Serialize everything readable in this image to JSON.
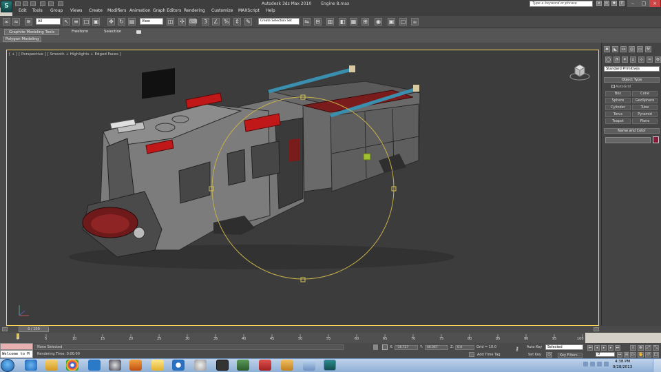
{
  "titlebar": {
    "app_name": "Autodesk 3ds Max 2010",
    "file_name": "Engine 8.max",
    "search_placeholder": "Type a keyword or phrase",
    "logo_glyph": "S"
  },
  "menu": [
    "Edit",
    "Tools",
    "Group",
    "Views",
    "Create",
    "Modifiers",
    "Animation",
    "Graph Editors",
    "Rendering",
    "Customize",
    "MAXScript",
    "Help"
  ],
  "toolbar": {
    "selection_filter": "All",
    "reference_coord": "View",
    "named_selection": "Create Selection Set"
  },
  "ribbon": {
    "tabs": [
      "Graphite Modeling Tools",
      "Freeform",
      "Selection"
    ],
    "panel_label": "Polygon Modeling"
  },
  "viewport": {
    "label": "[ + ] [ Perspective ] [ Smooth + Highlights + Edged Faces ]"
  },
  "command_panel": {
    "category": "Standard Primitives",
    "object_type_title": "Object Type",
    "autogrid_label": "AutoGrid",
    "primitives": [
      "Box",
      "Cone",
      "Sphere",
      "GeoSphere",
      "Cylinder",
      "Tube",
      "Torus",
      "Pyramid",
      "Teapot",
      "Plane"
    ],
    "name_color_title": "Name and Color",
    "object_color": "#8b1838"
  },
  "timeline": {
    "slider_label": "0 / 100",
    "ticks": [
      "0",
      "5",
      "10",
      "15",
      "20",
      "25",
      "30",
      "35",
      "40",
      "45",
      "50",
      "55",
      "60",
      "65",
      "70",
      "75",
      "80",
      "85",
      "90",
      "95",
      "100"
    ]
  },
  "status": {
    "selection_text": "None Selected",
    "render_time": "Rendering Time: 0:00:00",
    "welcome": "Welcome to M",
    "x_label": "X:",
    "x_value": "-16.727",
    "y_label": "Y:",
    "y_value": "46.047",
    "z_label": "Z:",
    "z_value": "0.0",
    "grid": "Grid = 10.0",
    "add_time_tag": "Add Time Tag",
    "auto_key": "Auto Key",
    "set_key": "Set Key",
    "key_filters": "Key Filters...",
    "key_mode": "Selected",
    "frame": "0"
  },
  "clock": {
    "time": "4:38 PM",
    "date": "9/28/2013"
  }
}
